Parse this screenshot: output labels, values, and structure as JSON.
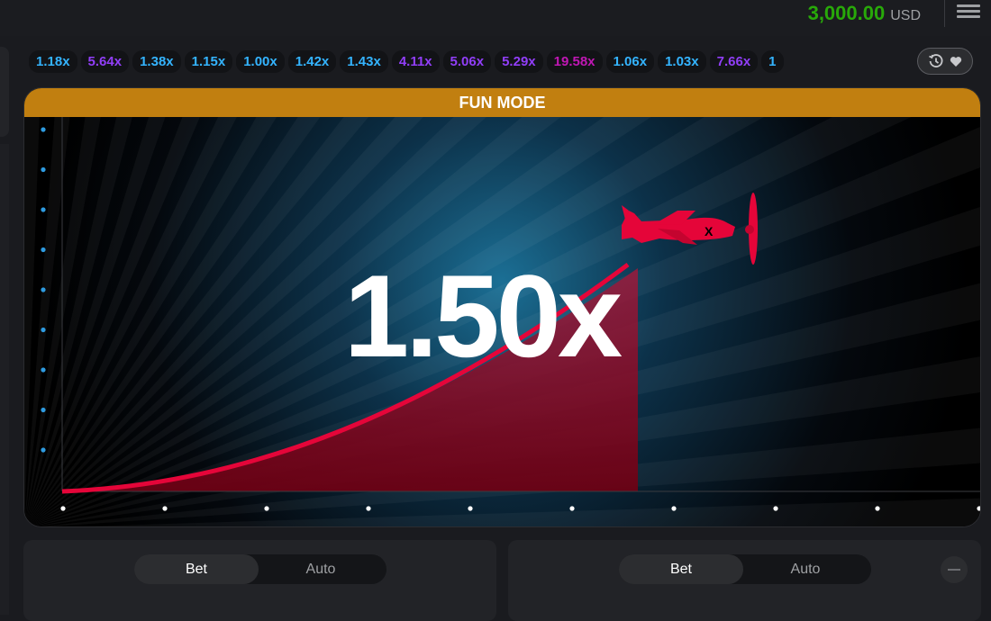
{
  "header": {
    "balance_amount": "3,000.00",
    "balance_currency": "USD",
    "menu_icon": "hamburger-menu-icon"
  },
  "history": {
    "items": [
      {
        "value": "1.18x",
        "color": "#34b4ff"
      },
      {
        "value": "5.64x",
        "color": "#913ef8"
      },
      {
        "value": "1.38x",
        "color": "#34b4ff"
      },
      {
        "value": "1.15x",
        "color": "#34b4ff"
      },
      {
        "value": "1.00x",
        "color": "#34b4ff"
      },
      {
        "value": "1.42x",
        "color": "#34b4ff"
      },
      {
        "value": "1.43x",
        "color": "#34b4ff"
      },
      {
        "value": "4.11x",
        "color": "#913ef8"
      },
      {
        "value": "5.06x",
        "color": "#913ef8"
      },
      {
        "value": "5.29x",
        "color": "#913ef8"
      },
      {
        "value": "19.58x",
        "color": "#c017b4"
      },
      {
        "value": "1.06x",
        "color": "#34b4ff"
      },
      {
        "value": "1.03x",
        "color": "#34b4ff"
      },
      {
        "value": "7.66x",
        "color": "#913ef8"
      },
      {
        "value": "1",
        "color": "#34b4ff"
      }
    ],
    "history_icon": "clock-history-icon",
    "favorite_icon": "heart-icon"
  },
  "game": {
    "mode_label": "FUN MODE",
    "multiplier": "1.50x",
    "banner_color": "#c17f10",
    "curve_color": "#e50539",
    "plane_icon": "red-plane-icon"
  },
  "bet_panels": [
    {
      "tabs": [
        "Bet",
        "Auto"
      ],
      "active": "Bet"
    },
    {
      "tabs": [
        "Bet",
        "Auto"
      ],
      "active": "Bet"
    }
  ]
}
